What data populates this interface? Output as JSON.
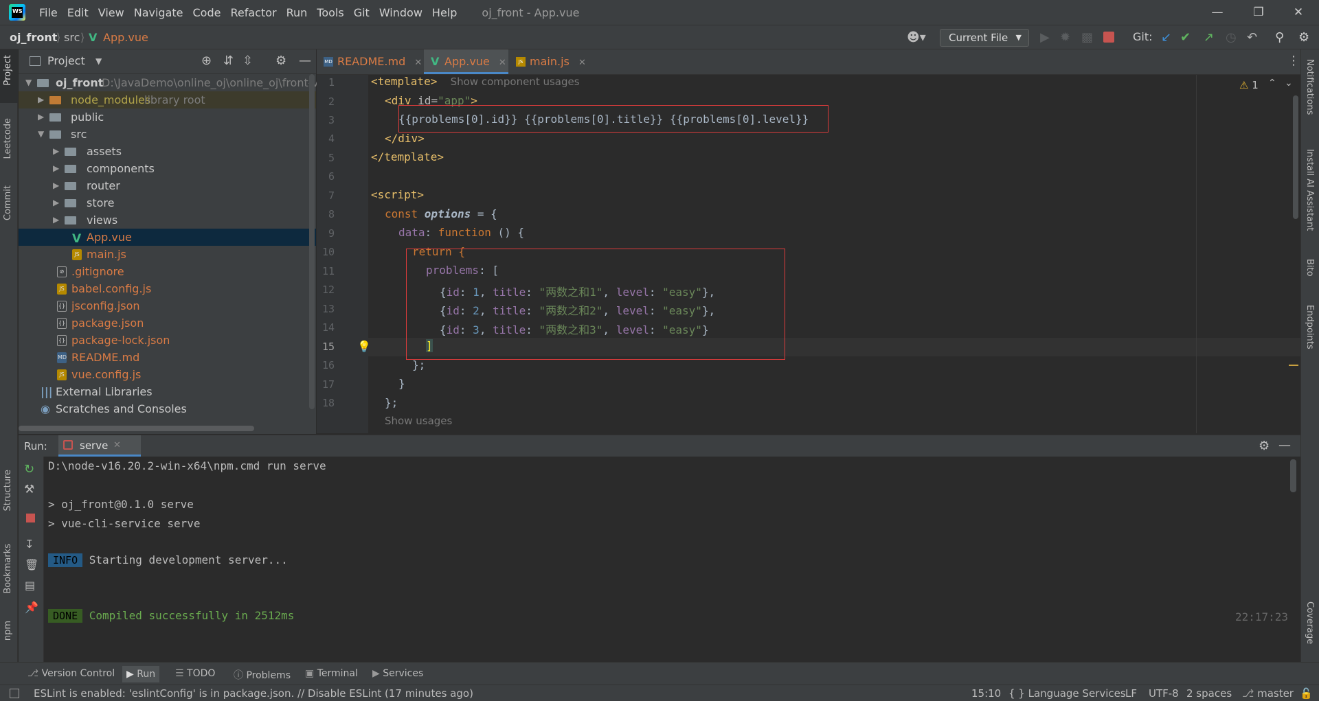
{
  "app": {
    "logo_text": "WS"
  },
  "menu": [
    "File",
    "Edit",
    "View",
    "Navigate",
    "Code",
    "Refactor",
    "Run",
    "Tools",
    "Git",
    "Window",
    "Help"
  ],
  "window_title": "oj_front - App.vue",
  "breadcrumb": {
    "project": "oj_front",
    "folder": "src",
    "file": "App.vue"
  },
  "toolbar": {
    "run_config": "Current File",
    "git_label": "Git:"
  },
  "left_tools": {
    "project": "Project",
    "leetcode": "Leetcode",
    "commit": "Commit",
    "structure": "Structure",
    "bookmarks": "Bookmarks",
    "npm": "npm"
  },
  "right_tools": {
    "notifications": "Notifications",
    "ai": "Install AI Assistant",
    "bito": "Bito",
    "endpoints": "Endpoints",
    "coverage": "Coverage"
  },
  "project_panel": {
    "title": "Project",
    "root": {
      "name": "oj_front",
      "path": "D:\\JavaDemo\\online_oj\\online_oj\\front-vue"
    },
    "items": [
      {
        "name": "node_modules",
        "suffix": "library root"
      },
      {
        "name": "public"
      },
      {
        "name": "src"
      },
      {
        "name": "assets"
      },
      {
        "name": "components"
      },
      {
        "name": "router"
      },
      {
        "name": "store"
      },
      {
        "name": "views"
      },
      {
        "name": "App.vue"
      },
      {
        "name": "main.js"
      },
      {
        "name": ".gitignore"
      },
      {
        "name": "babel.config.js"
      },
      {
        "name": "jsconfig.json"
      },
      {
        "name": "package.json"
      },
      {
        "name": "package-lock.json"
      },
      {
        "name": "README.md"
      },
      {
        "name": "vue.config.js"
      },
      {
        "name": "External Libraries"
      },
      {
        "name": "Scratches and Consoles"
      }
    ]
  },
  "editor": {
    "tabs": [
      {
        "label": "README.md",
        "icon": "MD"
      },
      {
        "label": "App.vue",
        "icon": "V"
      },
      {
        "label": "main.js",
        "icon": "JS"
      }
    ],
    "warning_count": "1",
    "hints": {
      "component_usages": "Show component usages",
      "usages": "Show usages"
    },
    "line_numbers": [
      "1",
      "2",
      "3",
      "4",
      "5",
      "6",
      "7",
      "8",
      "9",
      "10",
      "11",
      "12",
      "13",
      "14",
      "15",
      "16",
      "17",
      "18"
    ],
    "code": {
      "l1_tag": "<template>",
      "l2_open": "<div ",
      "l2_attr": "id=",
      "l2_val": "\"app\"",
      "l2_close": ">",
      "l3": "{{problems[0].id}} {{problems[0].title}} {{problems[0].level}}",
      "l4": "</div>",
      "l5": "</template>",
      "l7": "<script>",
      "l8_kw": "const ",
      "l8_name": "options",
      "l8_rest": " = {",
      "l9_prop": "data",
      "l9_colon": ": ",
      "l9_kw": "function",
      "l9_rest": " () {",
      "l10": "return {",
      "l11_prop": "problems",
      "l11_rest": ": [",
      "rows": [
        {
          "id": "1",
          "title": "\"两数之和1\"",
          "level": "\"easy\"",
          "end": "},"
        },
        {
          "id": "2",
          "title": "\"两数之和2\"",
          "level": "\"easy\"",
          "end": "},"
        },
        {
          "id": "3",
          "title": "\"两数之和3\"",
          "level": "\"easy\"",
          "end": "}"
        }
      ],
      "key_id": "id",
      "key_title": "title",
      "key_level": "level",
      "l15": "]",
      "l16": "};",
      "l17": "}",
      "l18": "};"
    }
  },
  "run": {
    "label": "Run:",
    "tab": "serve",
    "lines": {
      "cmd": "D:\\node-v16.20.2-win-x64\\npm.cmd run serve",
      "l2": "> oj_front@0.1.0 serve",
      "l3": "> vue-cli-service serve",
      "info_badge": "INFO",
      "info_text": "Starting development server...",
      "done_badge": "DONE",
      "done_text": "Compiled successfully in 2512ms",
      "time": "22:17:23"
    }
  },
  "bottom_tools": [
    "Version Control",
    "Run",
    "TODO",
    "Problems",
    "Terminal",
    "Services"
  ],
  "status": {
    "message": "ESLint is enabled: 'eslintConfig' is in package.json. // Disable ESLint (17 minutes ago)",
    "position": "15:10",
    "lang": "{ } Language Services",
    "line_sep": "LF",
    "encoding": "UTF-8",
    "indent": "2 spaces",
    "branch": "master"
  },
  "colors": {
    "accent": "#4a88c7",
    "highlight_box": "#e03c3c",
    "vue_green": "#41b883"
  }
}
